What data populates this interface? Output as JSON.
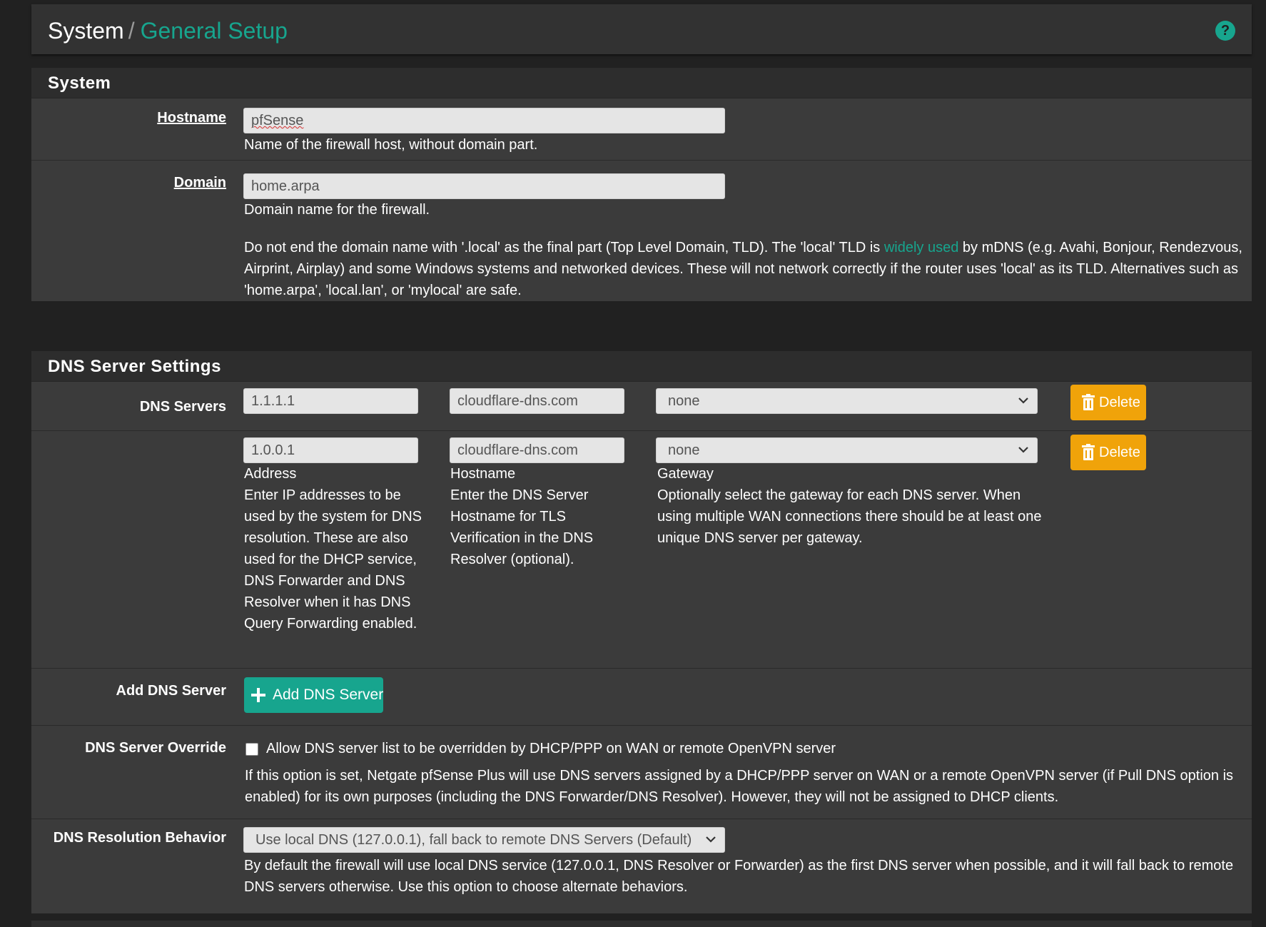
{
  "breadcrumb": {
    "root": "System",
    "separator": "/",
    "current": "General Setup"
  },
  "help_button": "?",
  "system_panel": {
    "title": "System",
    "hostname": {
      "label": "Hostname",
      "value": "pfSense",
      "help": "Name of the firewall host, without domain part."
    },
    "domain": {
      "label": "Domain",
      "value": "home.arpa",
      "help": "Domain name for the firewall.",
      "note_before": "Do not end the domain name with '.local' as the final part (Top Level Domain, TLD). The 'local' TLD is ",
      "note_link": "widely used",
      "note_after": " by mDNS (e.g. Avahi, Bonjour, Rendezvous, Airprint, Airplay) and some Windows systems and networked devices. These will not network correctly if the router uses 'local' as its TLD. Alternatives such as 'home.arpa', 'local.lan', or 'mylocal' are safe."
    }
  },
  "dns_panel": {
    "title": "DNS Server Settings",
    "servers_label": "DNS Servers",
    "servers": [
      {
        "address": "1.1.1.1",
        "hostname": "cloudflare-dns.com",
        "gateway": "none",
        "delete_label": "Delete"
      },
      {
        "address": "1.0.0.1",
        "hostname": "cloudflare-dns.com",
        "gateway": "none",
        "delete_label": "Delete"
      }
    ],
    "address_help": {
      "title": "Address",
      "text": "Enter IP addresses to be used by the system for DNS resolution. These are also used for the DHCP service, DNS Forwarder and DNS Resolver when it has DNS Query Forwarding enabled."
    },
    "hostname_help": {
      "title": "Hostname",
      "text": "Enter the DNS Server Hostname for TLS Verification in the DNS Resolver (optional)."
    },
    "gateway_help": {
      "title": "Gateway",
      "text": "Optionally select the gateway for each DNS server. When using multiple WAN connections there should be at least one unique DNS server per gateway."
    },
    "add": {
      "label": "Add DNS Server",
      "button": "Add DNS Server"
    },
    "override": {
      "label": "DNS Server Override",
      "checkbox_label": "Allow DNS server list to be overridden by DHCP/PPP on WAN or remote OpenVPN server",
      "checked": false,
      "help": "If this option is set, Netgate pfSense Plus will use DNS servers assigned by a DHCP/PPP server on WAN or a remote OpenVPN server (if Pull DNS option is enabled) for its own purposes (including the DNS Forwarder/DNS Resolver). However, they will not be assigned to DHCP clients."
    },
    "resolution": {
      "label": "DNS Resolution Behavior",
      "value": "Use local DNS (127.0.0.1), fall back to remote DNS Servers (Default)",
      "help": "By default the firewall will use local DNS service (127.0.0.1, DNS Resolver or Forwarder) as the first DNS server when possible, and it will fall back to remote DNS servers otherwise. Use this option to choose alternate behaviors."
    }
  },
  "colors": {
    "accent": "#17a58e",
    "warning": "#f0a30a",
    "panel_bg": "#3b3b3b",
    "page_bg": "#212121"
  }
}
